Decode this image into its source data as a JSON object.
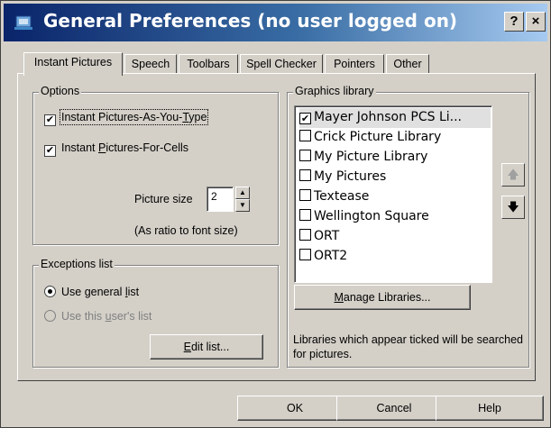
{
  "window": {
    "title": "General Preferences (no user logged on)",
    "help_glyph": "?",
    "close_glyph": "×",
    "icon": "speech-window-icon"
  },
  "tabs": [
    {
      "label": "Instant Pictures",
      "active": true
    },
    {
      "label": "Speech",
      "active": false
    },
    {
      "label": "Toolbars",
      "active": false
    },
    {
      "label": "Spell Checker",
      "active": false
    },
    {
      "label": "Pointers",
      "active": false
    },
    {
      "label": "Other",
      "active": false
    }
  ],
  "options": {
    "title": "Options",
    "as_you_type": {
      "label_pre": "Instant Pictures-As-You-",
      "label_key": "T",
      "label_post": "ype",
      "checked": true
    },
    "for_cells": {
      "label_pre": "Instant ",
      "label_key": "P",
      "label_post": "ictures-For-Cells",
      "checked": true
    },
    "picture_size_label": "Picture size",
    "picture_size_value": "2",
    "ratio_note": "(As ratio to font size)"
  },
  "exceptions": {
    "title": "Exceptions list",
    "general": {
      "label_pre": "Use general ",
      "label_key": "l",
      "label_post": "ist",
      "selected": true
    },
    "user": {
      "label_pre": "Use this ",
      "label_key": "u",
      "label_post": "ser's list",
      "selected": false,
      "disabled": true
    },
    "edit_button": {
      "label_key": "E",
      "label_post": "dit list..."
    }
  },
  "graphics": {
    "title": "Graphics library",
    "libraries": [
      {
        "name": "Mayer Johnson PCS Li...",
        "checked": true,
        "selected": true
      },
      {
        "name": "Crick Picture Library",
        "checked": false,
        "selected": false
      },
      {
        "name": "My Picture Library",
        "checked": false,
        "selected": false
      },
      {
        "name": "My Pictures",
        "checked": false,
        "selected": false
      },
      {
        "name": "Textease",
        "checked": false,
        "selected": false
      },
      {
        "name": "Wellington Square",
        "checked": false,
        "selected": false
      },
      {
        "name": "ORT",
        "checked": false,
        "selected": false
      },
      {
        "name": "ORT2",
        "checked": false,
        "selected": false
      }
    ],
    "manage_button": {
      "label_key": "M",
      "label_post": "anage Libraries..."
    },
    "note": "Libraries which appear ticked will be searched for pictures.",
    "move_up_icon": "up-arrow-icon",
    "move_down_icon": "down-arrow-icon"
  },
  "footer": {
    "ok": "OK",
    "cancel": "Cancel",
    "help": "Help"
  }
}
